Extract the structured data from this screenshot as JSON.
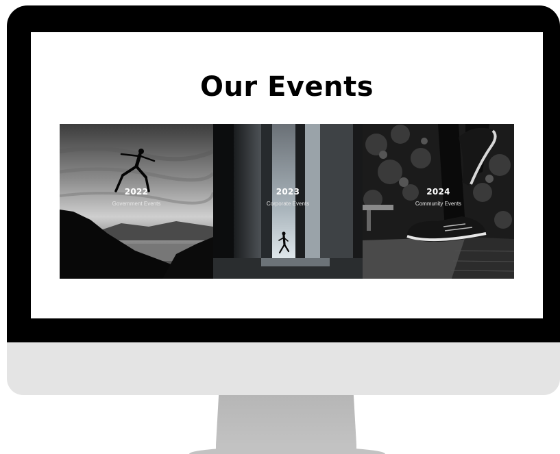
{
  "page": {
    "title": "Our Events"
  },
  "events": [
    {
      "year": "2022",
      "label": "Government Events",
      "image_icon": "jumping-runner-silhouette"
    },
    {
      "year": "2023",
      "label": "Corporate Events",
      "image_icon": "runner-in-corridor"
    },
    {
      "year": "2024",
      "label": "Community Events",
      "image_icon": "running-shoes"
    }
  ],
  "colors": {
    "bezel": "#000000",
    "chin": "#e4e4e4",
    "stand": "#bdbdbd",
    "screen_bg": "#ffffff",
    "text_on_image": "#ffffff"
  }
}
